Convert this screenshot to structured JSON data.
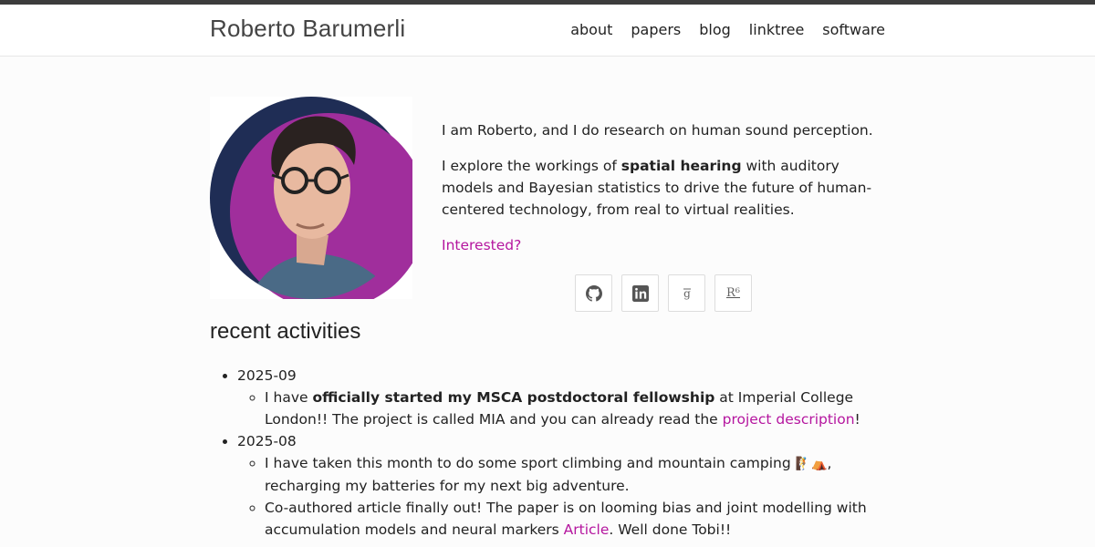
{
  "header": {
    "brand": "Roberto Barumerli",
    "nav": [
      "about",
      "papers",
      "blog",
      "linktree",
      "software"
    ]
  },
  "bio": {
    "p1": "I am Roberto, and I do research on human sound perception.",
    "p2_pre": "I explore the workings of ",
    "p2_bold": "spatial hearing",
    "p2_post": " with auditory models and Bayesian statistics to drive the future of human-centered technology, from real to virtual realities.",
    "interested": "Interested?"
  },
  "socials": [
    {
      "icon": "github-icon"
    },
    {
      "icon": "linkedin-icon"
    },
    {
      "icon": "google-scholar-icon"
    },
    {
      "icon": "researchgate-icon",
      "text": "R⁶"
    }
  ],
  "activities": {
    "title": "recent activities",
    "items": [
      {
        "date": "2025-09",
        "entries": [
          {
            "pre": "I have ",
            "bold": "officially started my MSCA postdoctoral fellowship",
            "mid": " at Imperial College London!! The project is called MIA and you can already read the ",
            "link": "project description",
            "post": "!"
          }
        ]
      },
      {
        "date": "2025-08",
        "entries": [
          {
            "pre": "I have taken this month to do some sport climbing and mountain camping ",
            "emoji": "🧗⛺",
            "post": ", recharging my batteries for my next big adventure."
          },
          {
            "pre": "Co-authored article finally out! The paper is on looming bias and joint modelling with accumulation models and neural markers ",
            "link": "Article",
            "post": ". Well done Tobi!!"
          }
        ]
      }
    ]
  },
  "colors": {
    "accent": "#b5169f",
    "topbar": "#3c3c3c"
  }
}
